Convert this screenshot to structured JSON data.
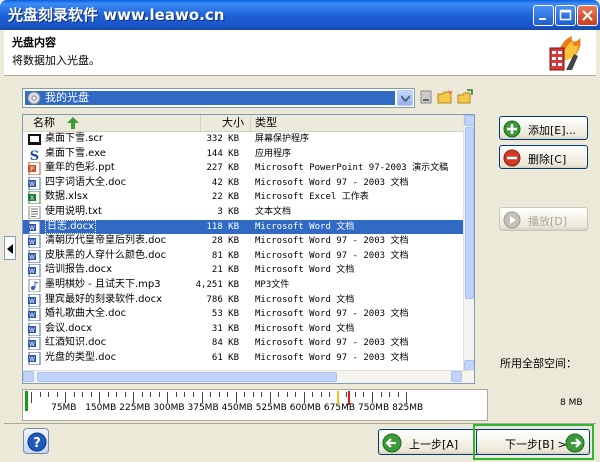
{
  "window": {
    "title": "光盘刻录软件 www.leawo.cn"
  },
  "header": {
    "title": "光盘内容",
    "subtitle": "将数据加入光盘。"
  },
  "drive": {
    "selected": "我的光盘"
  },
  "list": {
    "columns": [
      "名称",
      "大小",
      "类型"
    ],
    "files": [
      {
        "name": "桌面下雪.scr",
        "size": "332 KB",
        "type": "屏幕保护程序",
        "icon": "screensaver-icon"
      },
      {
        "name": "桌面下雪.exe",
        "size": "144 KB",
        "type": "应用程序",
        "icon": "app-icon"
      },
      {
        "name": "童年的色彩.ppt",
        "size": "227 KB",
        "type": "Microsoft PowerPoint 97-2003 演示文稿",
        "icon": "ppt-icon"
      },
      {
        "name": "四字词语大全.doc",
        "size": "42 KB",
        "type": "Microsoft Word 97 - 2003 文档",
        "icon": "word-icon"
      },
      {
        "name": "数据.xlsx",
        "size": "22 KB",
        "type": "Microsoft Excel 工作表",
        "icon": "excel-icon"
      },
      {
        "name": "使用说明.txt",
        "size": "3 KB",
        "type": "文本文档",
        "icon": "text-icon"
      },
      {
        "name": "日志.docx",
        "size": "118 KB",
        "type": "Microsoft Word 文档",
        "icon": "word-icon",
        "selected": true
      },
      {
        "name": "清朝历代皇帝皇后列表.doc",
        "size": "28 KB",
        "type": "Microsoft Word 97 - 2003 文档",
        "icon": "word-icon"
      },
      {
        "name": "皮肤黑的人穿什么颜色.doc",
        "size": "81 KB",
        "type": "Microsoft Word 97 - 2003 文档",
        "icon": "word-icon"
      },
      {
        "name": "培训报告.docx",
        "size": "21 KB",
        "type": "Microsoft Word 文档",
        "icon": "word-icon"
      },
      {
        "name": "墨明棋妙 - 且试天下.mp3",
        "size": "4,251 KB",
        "type": "MP3文件",
        "icon": "audio-icon"
      },
      {
        "name": "狸宾最好的刻录软件.docx",
        "size": "786 KB",
        "type": "Microsoft Word 文档",
        "icon": "word-icon"
      },
      {
        "name": "婚礼歌曲大全.doc",
        "size": "53 KB",
        "type": "Microsoft Word 97 - 2003 文档",
        "icon": "word-icon"
      },
      {
        "name": "会议.docx",
        "size": "31 KB",
        "type": "Microsoft Word 文档",
        "icon": "word-icon"
      },
      {
        "name": "红酒知识.doc",
        "size": "84 KB",
        "type": "Microsoft Word 97 - 2003 文档",
        "icon": "word-icon"
      },
      {
        "name": "光盘的类型.doc",
        "size": "61 KB",
        "type": "Microsoft Word 97 - 2003 文档",
        "icon": "word-icon"
      }
    ]
  },
  "buttons": {
    "add": "添加[E]...",
    "delete": "删除[C]",
    "play": "播放[D]",
    "back": "上一步[A]",
    "next": "下一步[B] >"
  },
  "capacity": {
    "label": "所用全部空间：",
    "used": "8 MB",
    "used_mb": 8,
    "scale_labels": [
      "75MB",
      "150MB",
      "225MB",
      "300MB",
      "375MB",
      "450MB",
      "525MB",
      "600MB",
      "675MB",
      "750MB",
      "825MB"
    ]
  },
  "colors": {
    "titlebar": "#1f62d8",
    "selection": "#316ac5",
    "fill": "#10a010"
  }
}
